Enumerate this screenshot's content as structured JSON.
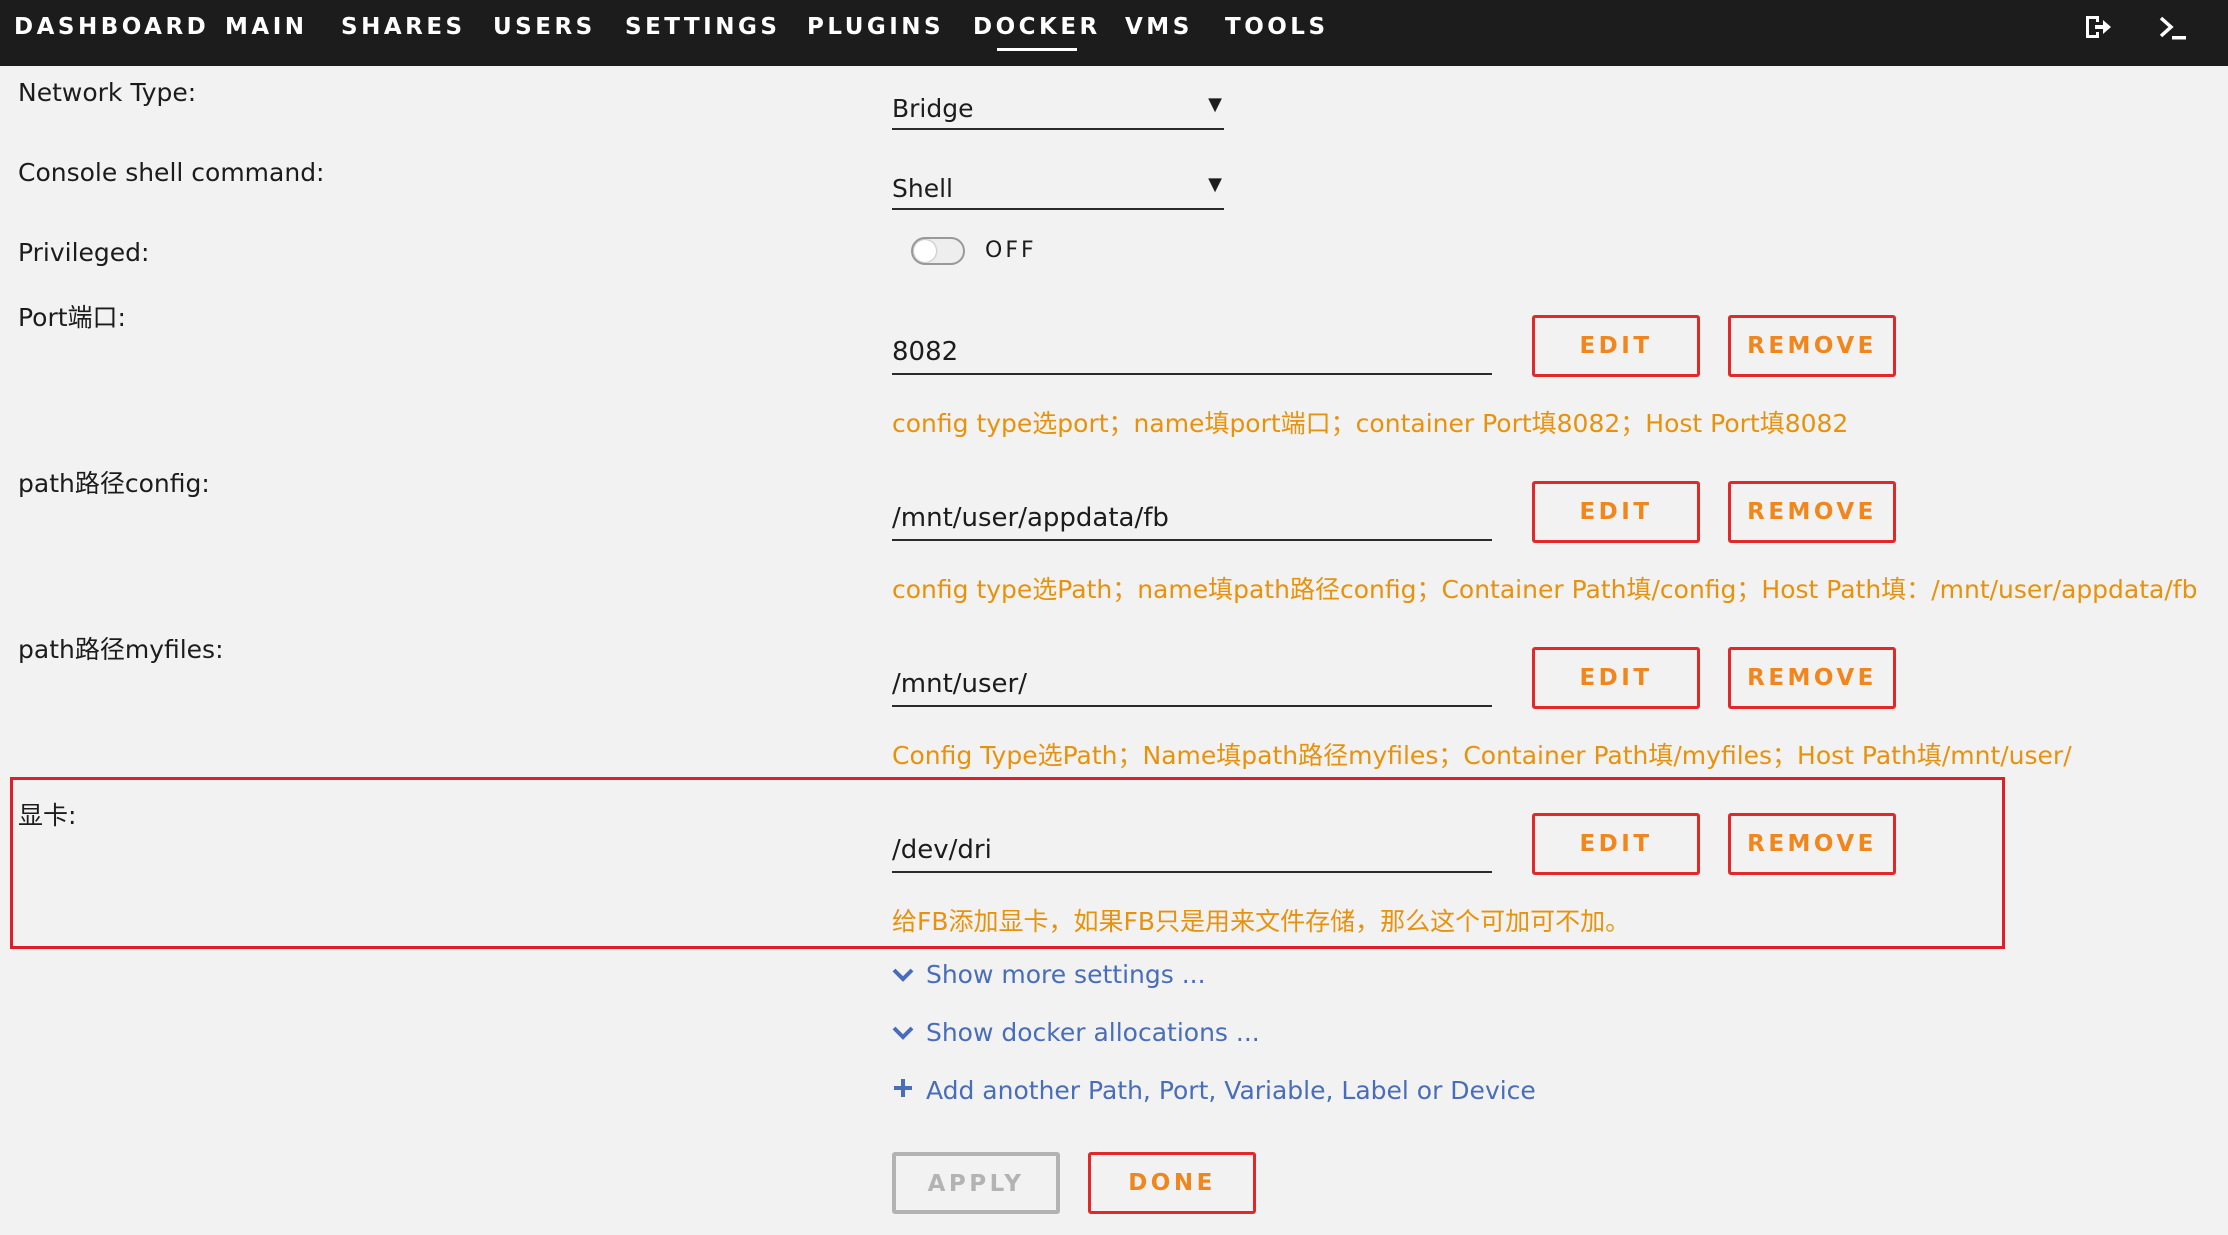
{
  "nav": {
    "items": [
      {
        "label": "DASHBOARD"
      },
      {
        "label": "MAIN"
      },
      {
        "label": "SHARES"
      },
      {
        "label": "USERS"
      },
      {
        "label": "SETTINGS"
      },
      {
        "label": "PLUGINS"
      },
      {
        "label": "DOCKER",
        "active": true
      },
      {
        "label": "VMS"
      },
      {
        "label": "TOOLS"
      }
    ],
    "icons": [
      "logout-icon",
      "terminal-icon"
    ]
  },
  "form": {
    "network_type": {
      "label": "Network Type:",
      "value": "Bridge"
    },
    "console_shell": {
      "label": "Console shell command:",
      "value": "Shell"
    },
    "privileged": {
      "label": "Privileged:",
      "state": "OFF"
    },
    "port": {
      "label": "Port端口:",
      "value": "8082",
      "hint": "config type选port；name填port端口；container Port填8082；Host Port填8082"
    },
    "path_config": {
      "label": "path路径config:",
      "value": "/mnt/user/appdata/fb",
      "hint": "config type选Path；name填path路径config；Container Path填/config；Host Path填：/mnt/user/appdata/fb"
    },
    "path_myfiles": {
      "label": "path路径myfiles:",
      "value": "/mnt/user/",
      "hint": "Config Type选Path；Name填path路径myfiles；Container Path填/myfiles；Host Path填/mnt/user/"
    },
    "gpu": {
      "label": "显卡:",
      "value": "/dev/dri",
      "hint": "给FB添加显卡，如果FB只是用来文件存储，那么这个可加可不加。"
    }
  },
  "buttons": {
    "edit": "EDIT",
    "remove": "REMOVE",
    "apply": "APPLY",
    "done": "DONE"
  },
  "links": {
    "more_settings": "Show more settings ...",
    "docker_allocations": "Show docker allocations ...",
    "add_another": "Add another Path, Port, Variable, Label or Device"
  },
  "colors": {
    "topbar": "#1c1c1c",
    "button_border": "#e22828",
    "button_text": "#f0861c",
    "hint": "#e8920c",
    "link": "#486dba",
    "highlight_box": "#e01e2b"
  }
}
